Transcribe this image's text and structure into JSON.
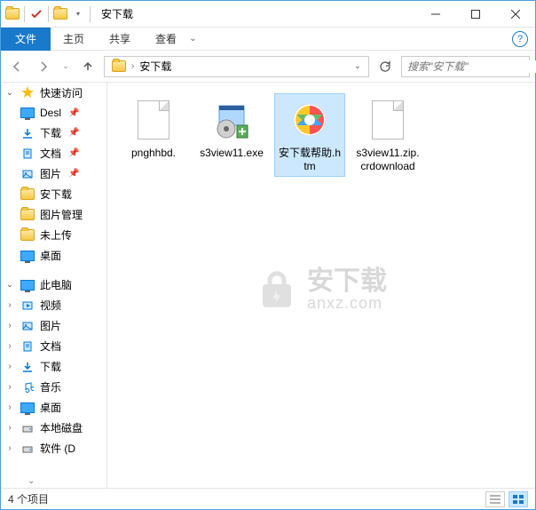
{
  "title": "安下载",
  "ribbon": {
    "file": "文件",
    "home": "主页",
    "share": "共享",
    "view": "查看"
  },
  "breadcrumb": {
    "folder": "安下载"
  },
  "search": {
    "placeholder": "搜索\"安下载\""
  },
  "sidebar": {
    "quick_access": "快速访问",
    "items": [
      {
        "label": "Desl",
        "icon": "desktop"
      },
      {
        "label": "下载",
        "icon": "downloads"
      },
      {
        "label": "文档",
        "icon": "documents"
      },
      {
        "label": "图片",
        "icon": "pictures"
      },
      {
        "label": "安下载",
        "icon": "folder"
      },
      {
        "label": "图片管理",
        "icon": "folder"
      },
      {
        "label": "未上传",
        "icon": "folder"
      },
      {
        "label": "桌面",
        "icon": "desktop"
      }
    ],
    "this_pc": "此电脑",
    "pc_items": [
      {
        "label": "视频",
        "icon": "videos"
      },
      {
        "label": "图片",
        "icon": "pictures"
      },
      {
        "label": "文档",
        "icon": "documents"
      },
      {
        "label": "下载",
        "icon": "downloads"
      },
      {
        "label": "音乐",
        "icon": "music"
      },
      {
        "label": "桌面",
        "icon": "desktop"
      },
      {
        "label": "本地磁盘",
        "icon": "disk"
      },
      {
        "label": "软件 (D",
        "icon": "disk"
      }
    ]
  },
  "files": [
    {
      "name": "pnghhbd.",
      "type": "doc",
      "selected": false
    },
    {
      "name": "s3view11.exe",
      "type": "exe",
      "selected": false
    },
    {
      "name": "安下载帮助.htm",
      "type": "htm",
      "selected": true
    },
    {
      "name": "s3view11.zip.crdownload",
      "type": "doc",
      "selected": false
    }
  ],
  "watermark": {
    "line1": "安下载",
    "line2": "anxz.com"
  },
  "statusbar": {
    "count": "4 个项目"
  }
}
